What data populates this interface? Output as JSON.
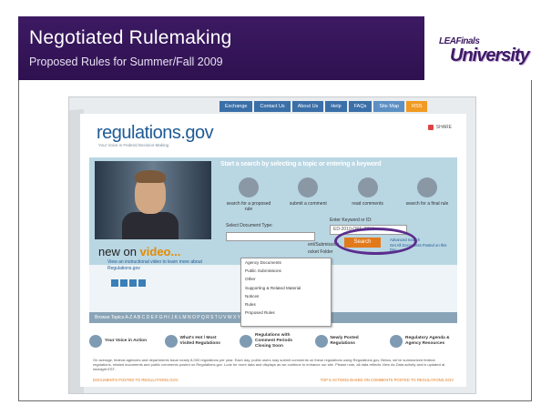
{
  "slide": {
    "title": "Negotiated Rulemaking",
    "subtitle": "Proposed Rules for Summer/Fall 2009",
    "logo_small": "LEAFinals",
    "logo_big": "University",
    "header_color": "#3d1a63",
    "highlight_color": "#5a2d8c"
  },
  "site": {
    "top_nav": [
      "Exchange",
      "Contact Us",
      "About Us",
      "Help",
      "FAQs",
      "Site Map",
      "RSS"
    ],
    "brand": "regulations.gov",
    "tagline": "Your Voice in Federal Decision-Making",
    "share_label": "SHARE",
    "search_band": "Start a search by selecting a topic or entering a keyword",
    "actions": [
      "search for a proposed rule",
      "submit a comment",
      "read comments",
      "search for a final rule"
    ],
    "video_heading_plain": "new on ",
    "video_heading_accent": "video...",
    "video_caption": "View an instructional video to learn more about Regulations.gov",
    "select_doc_type_label": "Select Document Type:",
    "enter_keyword_label": "Enter Keyword or ID:",
    "keyword_value": "ED-2010-OPE-0004",
    "search_button": "Search",
    "advanced_links": [
      "Advanced Search",
      "Get All Documents Posted on this Day"
    ],
    "side_text_1": "ent/Submission",
    "side_text_2": "ocket Folder",
    "dropdown_items": [
      "Agency Documents",
      "Public Submissions",
      "Other",
      "Supporting & Related Material",
      "Notices",
      "Rules",
      "Proposed Rules"
    ],
    "topics_label": "Browse Topics A-Z",
    "topics_letters": "A B C D E F G H I J K L M N O P Q R S T U V W X Y Z",
    "features": [
      {
        "label": "Your Voice in Action"
      },
      {
        "label": "What's Hot / Most Visited Regulations"
      },
      {
        "label": "Regulations with Comment Periods Closing Soon"
      },
      {
        "label": "Newly Posted Regulations"
      },
      {
        "label": "Regulatory Agenda & Agency Resources"
      }
    ],
    "description": "On average, federal agencies and departments issue nearly 8,000 regulations per year. Each day, public users may submit comments on these regulations using Regulations.gov. Below, we've summarized federal regulations, related documents and public comments posted on Regulations.gov. Look for more data and displays as we continue to enhance our site. Please note, all data reflects View As Data activity and is updated at midnight EST.",
    "footer_left": "DOCUMENTS POSTED TO REGULATIONS.GOV",
    "footer_right": "TOP 5 ACTIONS BASED ON COMMENTS POSTED TO REGULATIONS.GOV"
  }
}
